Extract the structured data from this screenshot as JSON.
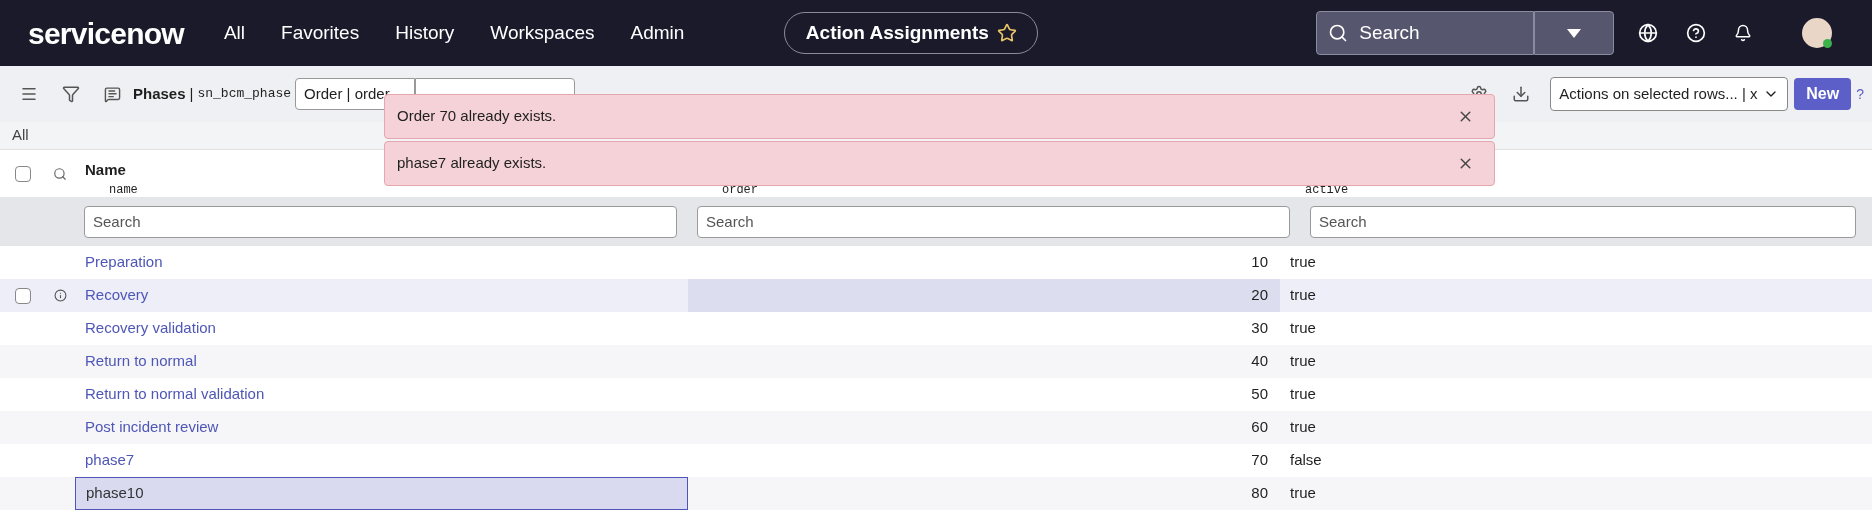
{
  "nav": {
    "logo": "servicenow",
    "items": [
      "All",
      "Favorites",
      "History",
      "Workspaces",
      "Admin"
    ],
    "context_title": "Action Assignments",
    "context_starred": false,
    "search_placeholder": "Search"
  },
  "toolbar": {
    "list_title": "Phases",
    "separator": "|",
    "table_name": "sn_bcm_phase",
    "field_select": "Order | order",
    "actions_select": "Actions on selected rows... | x",
    "new_button": "New",
    "help": "?"
  },
  "alerts": [
    {
      "message": "Order 70 already exists."
    },
    {
      "message": "phase7 already exists."
    }
  ],
  "breadcrumb": "All",
  "select_all_checked": false,
  "columns": [
    {
      "label": "Name",
      "field": "name",
      "search_placeholder": "Search"
    },
    {
      "field": "order",
      "search_placeholder": "Search"
    },
    {
      "field": "active",
      "search_placeholder": "Search"
    }
  ],
  "rows": [
    {
      "name": "Preparation",
      "order": "10",
      "active": "true",
      "hovered": false,
      "name_selected": false,
      "order_highlighted": false
    },
    {
      "name": "Recovery",
      "order": "20",
      "active": "true",
      "hovered": true,
      "name_selected": false,
      "order_highlighted": true
    },
    {
      "name": "Recovery validation",
      "order": "30",
      "active": "true",
      "hovered": false,
      "name_selected": false,
      "order_highlighted": false
    },
    {
      "name": "Return to normal",
      "order": "40",
      "active": "true",
      "hovered": false,
      "name_selected": false,
      "order_highlighted": false
    },
    {
      "name": "Return to normal validation",
      "order": "50",
      "active": "true",
      "hovered": false,
      "name_selected": false,
      "order_highlighted": false
    },
    {
      "name": "Post incident review",
      "order": "60",
      "active": "true",
      "hovered": false,
      "name_selected": false,
      "order_highlighted": false
    },
    {
      "name": "phase7",
      "order": "70",
      "active": "false",
      "hovered": false,
      "name_selected": false,
      "order_highlighted": false
    },
    {
      "name": "phase10",
      "order": "80",
      "active": "true",
      "hovered": false,
      "name_selected": true,
      "order_highlighted": false
    }
  ]
}
